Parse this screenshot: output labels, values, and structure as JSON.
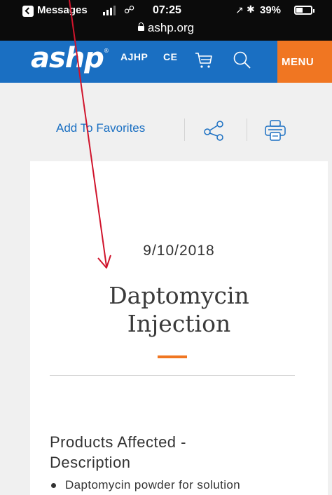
{
  "status_bar": {
    "back_app": "Messages",
    "time": "07:25",
    "battery": "39%",
    "url": "ashp.org"
  },
  "header": {
    "logo": "ashp",
    "nav": [
      "AJHP",
      "CE"
    ],
    "menu_label": "MENU",
    "colors": {
      "brand_blue": "#1a6fc2",
      "accent_orange": "#f07622"
    }
  },
  "actions": {
    "favorites_label": "Add To Favorites",
    "icons": [
      "share-icon",
      "print-icon"
    ]
  },
  "article": {
    "date": "9/10/2018",
    "title_line1": "Daptomycin",
    "title_line2": "Injection",
    "section_heading_line1": "Products Affected -",
    "section_heading_line2": "Description",
    "items": [
      "Daptomycin powder for solution"
    ]
  },
  "annotation": {
    "arrow_color": "#d0142c"
  }
}
